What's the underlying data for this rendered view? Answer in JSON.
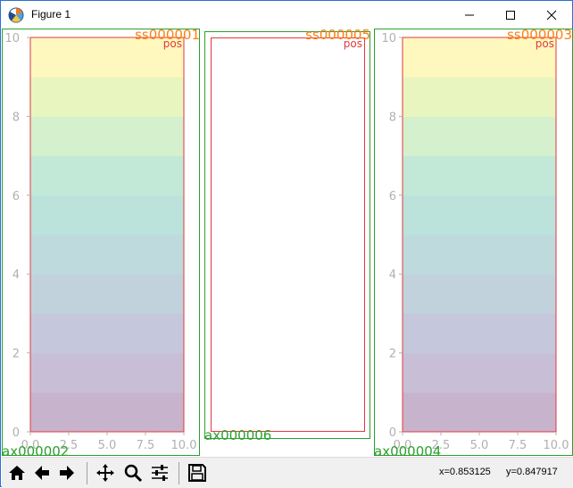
{
  "window": {
    "title": "Figure 1",
    "icon": "matplotlib-figure-icon",
    "controls": [
      "minimize-icon",
      "maximize-icon",
      "close-icon"
    ]
  },
  "figure": {
    "subplot_labels": [
      "ss000001",
      "ss000005",
      "ss000003"
    ],
    "axes_labels": [
      "ax000002",
      "ax000006",
      "ax000004"
    ],
    "pos_label": "pos",
    "colors": {
      "axes_frame": "#e0393e",
      "subplot_label": "#ff7f0e",
      "axes_label": "#2ca02c",
      "tick": "#b0b0b0"
    }
  },
  "chart_data": [
    {
      "type": "heatmap",
      "title": "",
      "xlim": [
        0,
        10
      ],
      "ylim": [
        0,
        10
      ],
      "xticks": [
        "0.0",
        "2.5",
        "5.0",
        "7.5",
        "10.0"
      ],
      "yticks": [
        "0",
        "2",
        "4",
        "6",
        "8",
        "10"
      ],
      "rows": 10,
      "colormap": "viridis",
      "alpha": 0.3
    },
    {
      "type": "table",
      "title": "",
      "empty": true
    },
    {
      "type": "heatmap",
      "title": "",
      "xlim": [
        0,
        10
      ],
      "ylim": [
        0,
        10
      ],
      "xticks": [
        "0.0",
        "2.5",
        "5.0",
        "7.5",
        "10.0"
      ],
      "yticks": [
        "0",
        "2",
        "4",
        "6",
        "8",
        "10"
      ],
      "rows": 10,
      "colormap": "viridis",
      "alpha": 0.3
    }
  ],
  "toolbar": {
    "buttons": [
      "home-icon",
      "back-icon",
      "forward-icon",
      "pan-icon",
      "zoom-icon",
      "configure-subplots-icon",
      "save-icon"
    ],
    "x_readout": "x=0.853125",
    "y_readout": "y=0.847917"
  }
}
